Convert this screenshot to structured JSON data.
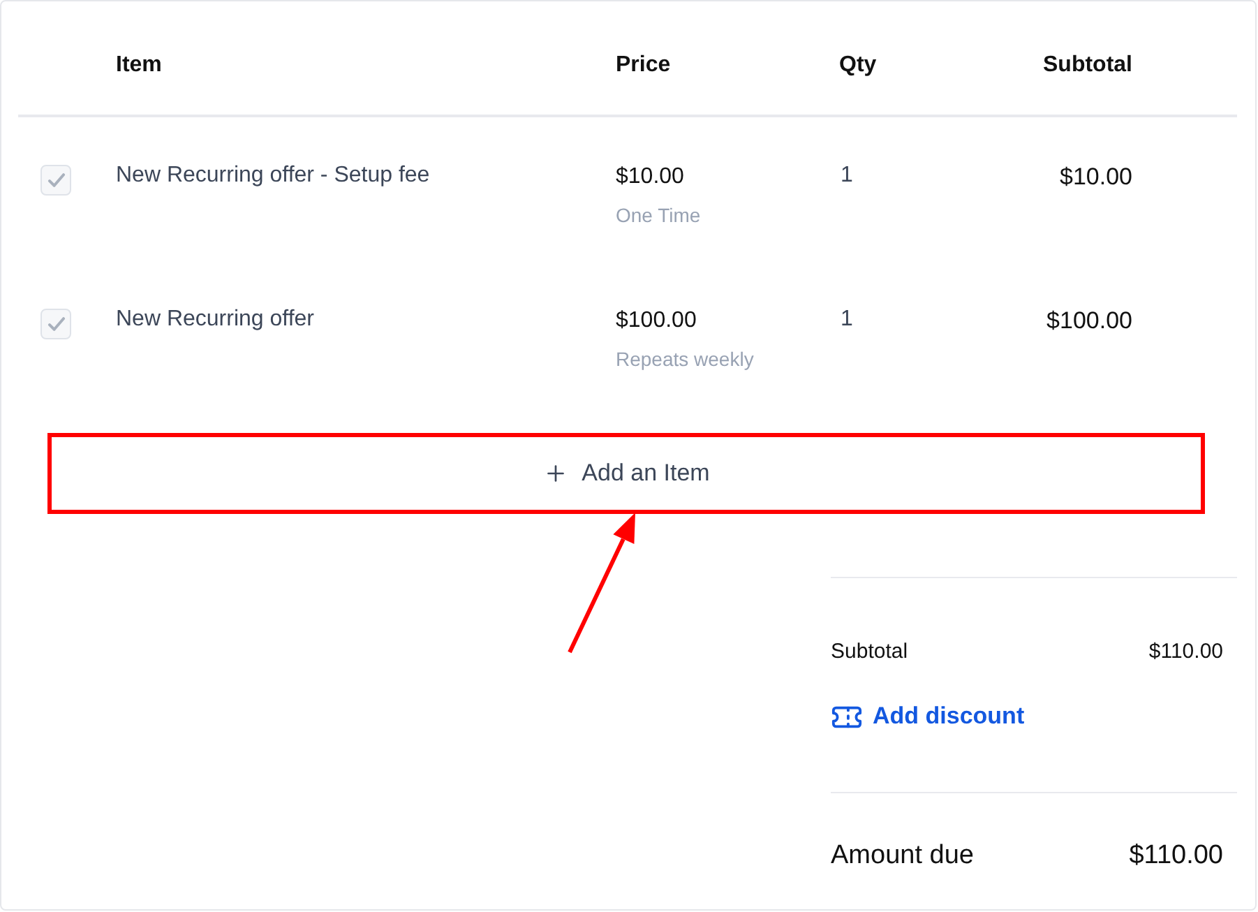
{
  "table": {
    "columns": [
      {
        "label": "Item"
      },
      {
        "label": "Price"
      },
      {
        "label": "Qty"
      },
      {
        "label": "Subtotal"
      }
    ],
    "rows": [
      {
        "checked": true,
        "disabled": true,
        "item": "New Recurring offer - Setup fee",
        "price": "$10.00",
        "billing": "One Time",
        "qty": "1",
        "subtotal": "$10.00"
      },
      {
        "checked": true,
        "disabled": true,
        "item": "New Recurring offer",
        "price": "$100.00",
        "billing": "Repeats weekly",
        "qty": "1",
        "subtotal": "$100.00"
      }
    ]
  },
  "add_item_button": {
    "label": "Add an Item"
  },
  "annotations": {
    "highlight_add_item": true,
    "arrow_to_add_item": true
  },
  "summary": {
    "subtotal_label": "Subtotal",
    "subtotal_value": "$110.00",
    "discount_link": "Add discount",
    "amount_due_label": "Amount due",
    "amount_due_value": "$110.00"
  }
}
